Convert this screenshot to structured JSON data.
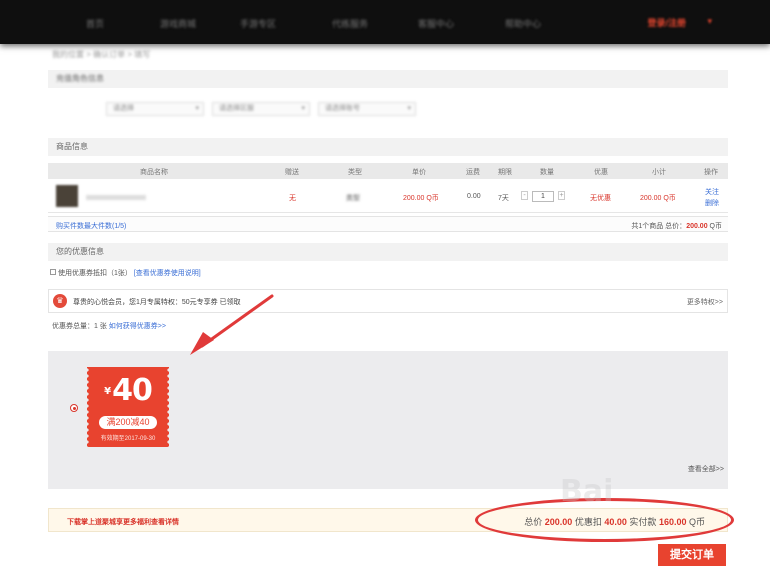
{
  "header": {
    "nav": [
      "首页",
      "游戏商城",
      "手游专区",
      "代练服务",
      "客服中心",
      "帮助中心"
    ],
    "login_label": "登录/注册"
  },
  "breadcrumb": "我的位置 > 确认订单 > 填写",
  "recharge_section": {
    "title": "充值角色信息",
    "role_select": "请选择",
    "server_select": "请选择区服",
    "account_select": "请选择账号"
  },
  "goods_section": {
    "title": "商品信息",
    "columns": [
      "商品名称",
      "赠送",
      "类型",
      "单价",
      "运费",
      "期限",
      "数量",
      "优惠",
      "小计",
      "操作"
    ],
    "row": {
      "gift": "无",
      "type": "类型",
      "unit_price": "200.00 Q币",
      "shipping": "0.00",
      "period": "7天",
      "quantity": "1",
      "discount": "无优惠",
      "subtotal": "200.00 Q币",
      "action_follow": "关注",
      "action_delete": "删除"
    },
    "footer_left": "购买件数最大件数(1/5)",
    "footer_right_prefix": "共1个商品 总价：",
    "footer_right_amount": "200.00",
    "footer_right_unit": " Q币"
  },
  "discount_section": {
    "title": "您的优惠信息",
    "use_coupon": "使用优惠券抵扣（1张）",
    "coupon_rules_link": "[查看优惠券使用说明]",
    "vip_text": "尊贵的心悦会员，您1月专属特权：50元专享券 已领取",
    "vip_more": "更多特权>>",
    "coupon_total_prefix": "优惠券总量：1 张",
    "coupon_how_link": "如何获得优惠券>>",
    "view_all": "查看全部>>"
  },
  "coupon": {
    "currency_symbol": "¥",
    "amount": "40",
    "condition": "满200减40",
    "expire": "有效期至2017-09-30"
  },
  "bottom": {
    "note": "下载掌上道聚城享更多福利查看详情",
    "total_label": "总价",
    "total_value": "200.00",
    "discount_label": "优惠扣",
    "discount_value": "40.00",
    "pay_label": "实付款",
    "pay_value": "160.00",
    "pay_unit": "Q币"
  },
  "submit_label": "提交订单",
  "colors": {
    "accent": "#e8432f",
    "annotation": "#e03a3a",
    "link": "#3b6fd6"
  }
}
